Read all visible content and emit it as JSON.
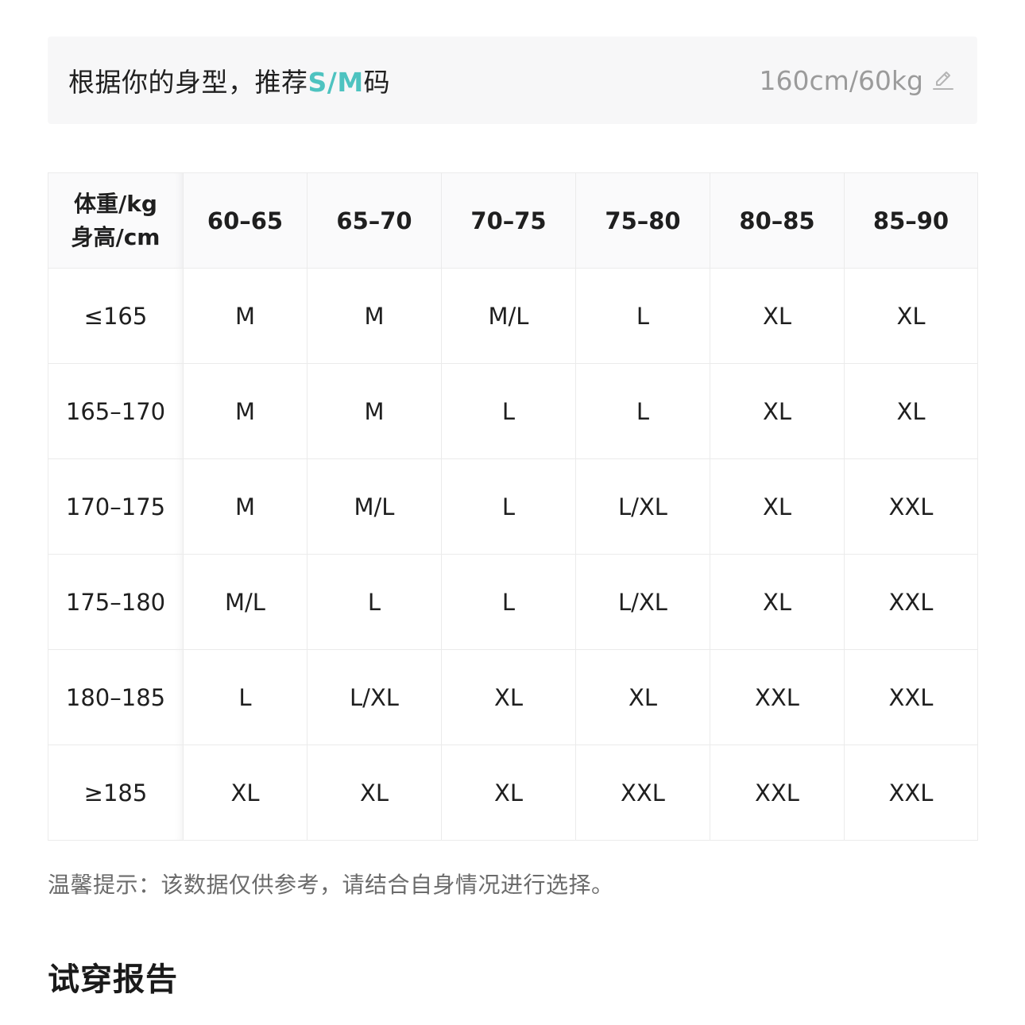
{
  "recommendation": {
    "prefix": "根据你的身型，推荐",
    "size": "S/M",
    "suffix": "码",
    "body_info": "160cm/60kg",
    "edit_icon": "edit-pencil-icon",
    "accent_color": "#4ec3c0"
  },
  "size_table": {
    "corner_top": "体重/kg",
    "corner_bottom": "身高/cm",
    "weight_headers": [
      "60–65",
      "65–70",
      "70–75",
      "75–80",
      "80–85",
      "85–90"
    ],
    "rows": [
      {
        "height": "≤165",
        "sizes": [
          "M",
          "M",
          "M/L",
          "L",
          "XL",
          "XL"
        ]
      },
      {
        "height": "165–170",
        "sizes": [
          "M",
          "M",
          "L",
          "L",
          "XL",
          "XL"
        ]
      },
      {
        "height": "170–175",
        "sizes": [
          "M",
          "M/L",
          "L",
          "L/XL",
          "XL",
          "XXL"
        ]
      },
      {
        "height": "175–180",
        "sizes": [
          "M/L",
          "L",
          "L",
          "L/XL",
          "XL",
          "XXL"
        ]
      },
      {
        "height": "180–185",
        "sizes": [
          "L",
          "L/XL",
          "XL",
          "XL",
          "XXL",
          "XXL"
        ]
      },
      {
        "height": "≥185",
        "sizes": [
          "XL",
          "XL",
          "XL",
          "XXL",
          "XXL",
          "XXL"
        ]
      }
    ]
  },
  "tip": "温馨提示：该数据仅供参考，请结合自身情况进行选择。",
  "section_title": "试穿报告"
}
